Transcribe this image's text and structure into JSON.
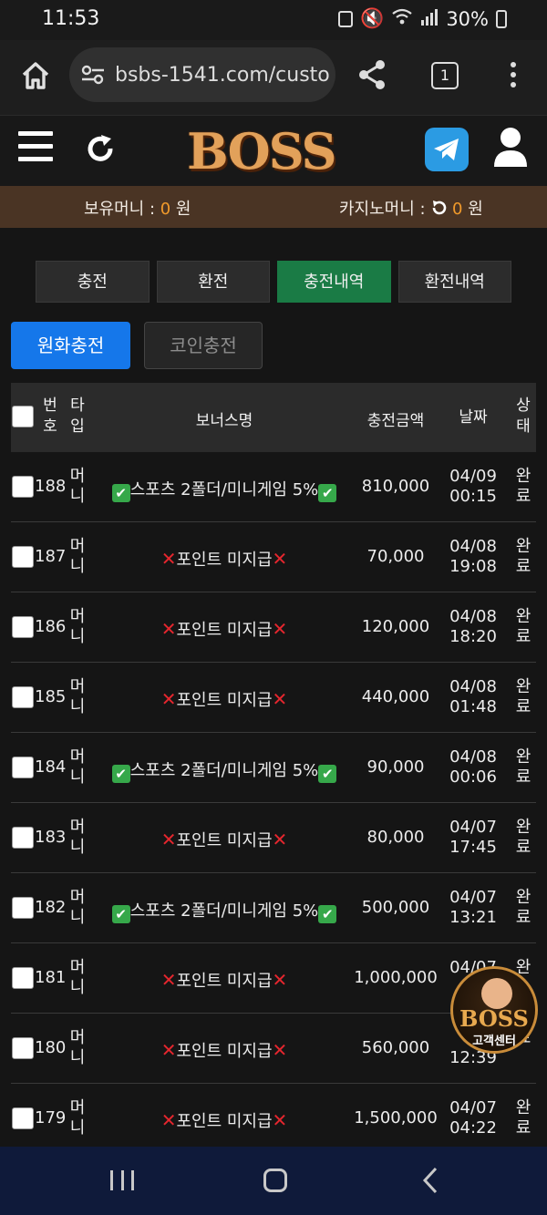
{
  "status_bar": {
    "time": "11:53",
    "battery": "30%"
  },
  "browser": {
    "url": "bsbs-1541.com/custo",
    "tab_count": "1"
  },
  "header": {
    "logo_text": "BOSS"
  },
  "money": {
    "holding_label": "보유머니 : ",
    "holding_value": "0",
    "holding_unit": " 원",
    "casino_label": "카지노머니 : ",
    "casino_value": "0",
    "casino_unit": " 원"
  },
  "tabs": [
    {
      "label": "충전",
      "active": false
    },
    {
      "label": "환전",
      "active": false
    },
    {
      "label": "충전내역",
      "active": true
    },
    {
      "label": "환전내역",
      "active": false
    }
  ],
  "subtabs": {
    "krw_label": "원화충전",
    "coin_label": "코인충전"
  },
  "table": {
    "headers": {
      "no": "번호",
      "type": "타입",
      "bonus": "보너스명",
      "amount": "충전금액",
      "date": "날짜",
      "status": "상태"
    },
    "rows": [
      {
        "no": "188",
        "type": "머니",
        "bonus_ok": true,
        "bonus": "스포츠 2폴더/미니게임 5%",
        "amount": "810,000",
        "date": "04/09",
        "time": "00:15",
        "status": "완료"
      },
      {
        "no": "187",
        "type": "머니",
        "bonus_ok": false,
        "bonus": "포인트 미지급",
        "amount": "70,000",
        "date": "04/08",
        "time": "19:08",
        "status": "완료"
      },
      {
        "no": "186",
        "type": "머니",
        "bonus_ok": false,
        "bonus": "포인트 미지급",
        "amount": "120,000",
        "date": "04/08",
        "time": "18:20",
        "status": "완료"
      },
      {
        "no": "185",
        "type": "머니",
        "bonus_ok": false,
        "bonus": "포인트 미지급",
        "amount": "440,000",
        "date": "04/08",
        "time": "01:48",
        "status": "완료"
      },
      {
        "no": "184",
        "type": "머니",
        "bonus_ok": true,
        "bonus": "스포츠 2폴더/미니게임 5%",
        "amount": "90,000",
        "date": "04/08",
        "time": "00:06",
        "status": "완료"
      },
      {
        "no": "183",
        "type": "머니",
        "bonus_ok": false,
        "bonus": "포인트 미지급",
        "amount": "80,000",
        "date": "04/07",
        "time": "17:45",
        "status": "완료"
      },
      {
        "no": "182",
        "type": "머니",
        "bonus_ok": true,
        "bonus": "스포츠 2폴더/미니게임 5%",
        "amount": "500,000",
        "date": "04/07",
        "time": "13:21",
        "status": "완료"
      },
      {
        "no": "181",
        "type": "머니",
        "bonus_ok": false,
        "bonus": "포인트 미지급",
        "amount": "1,000,000",
        "date": "04/07",
        "time": "1",
        "status": "완"
      },
      {
        "no": "180",
        "type": "머니",
        "bonus_ok": false,
        "bonus": "포인트 미지급",
        "amount": "560,000",
        "date": "0",
        "time": "12:39",
        "status": "료"
      },
      {
        "no": "179",
        "type": "머니",
        "bonus_ok": false,
        "bonus": "포인트 미지급",
        "amount": "1,500,000",
        "date": "04/07",
        "time": "04:22",
        "status": "완료"
      }
    ]
  },
  "floating": {
    "brand": "BOSS",
    "label": "고객센터"
  }
}
